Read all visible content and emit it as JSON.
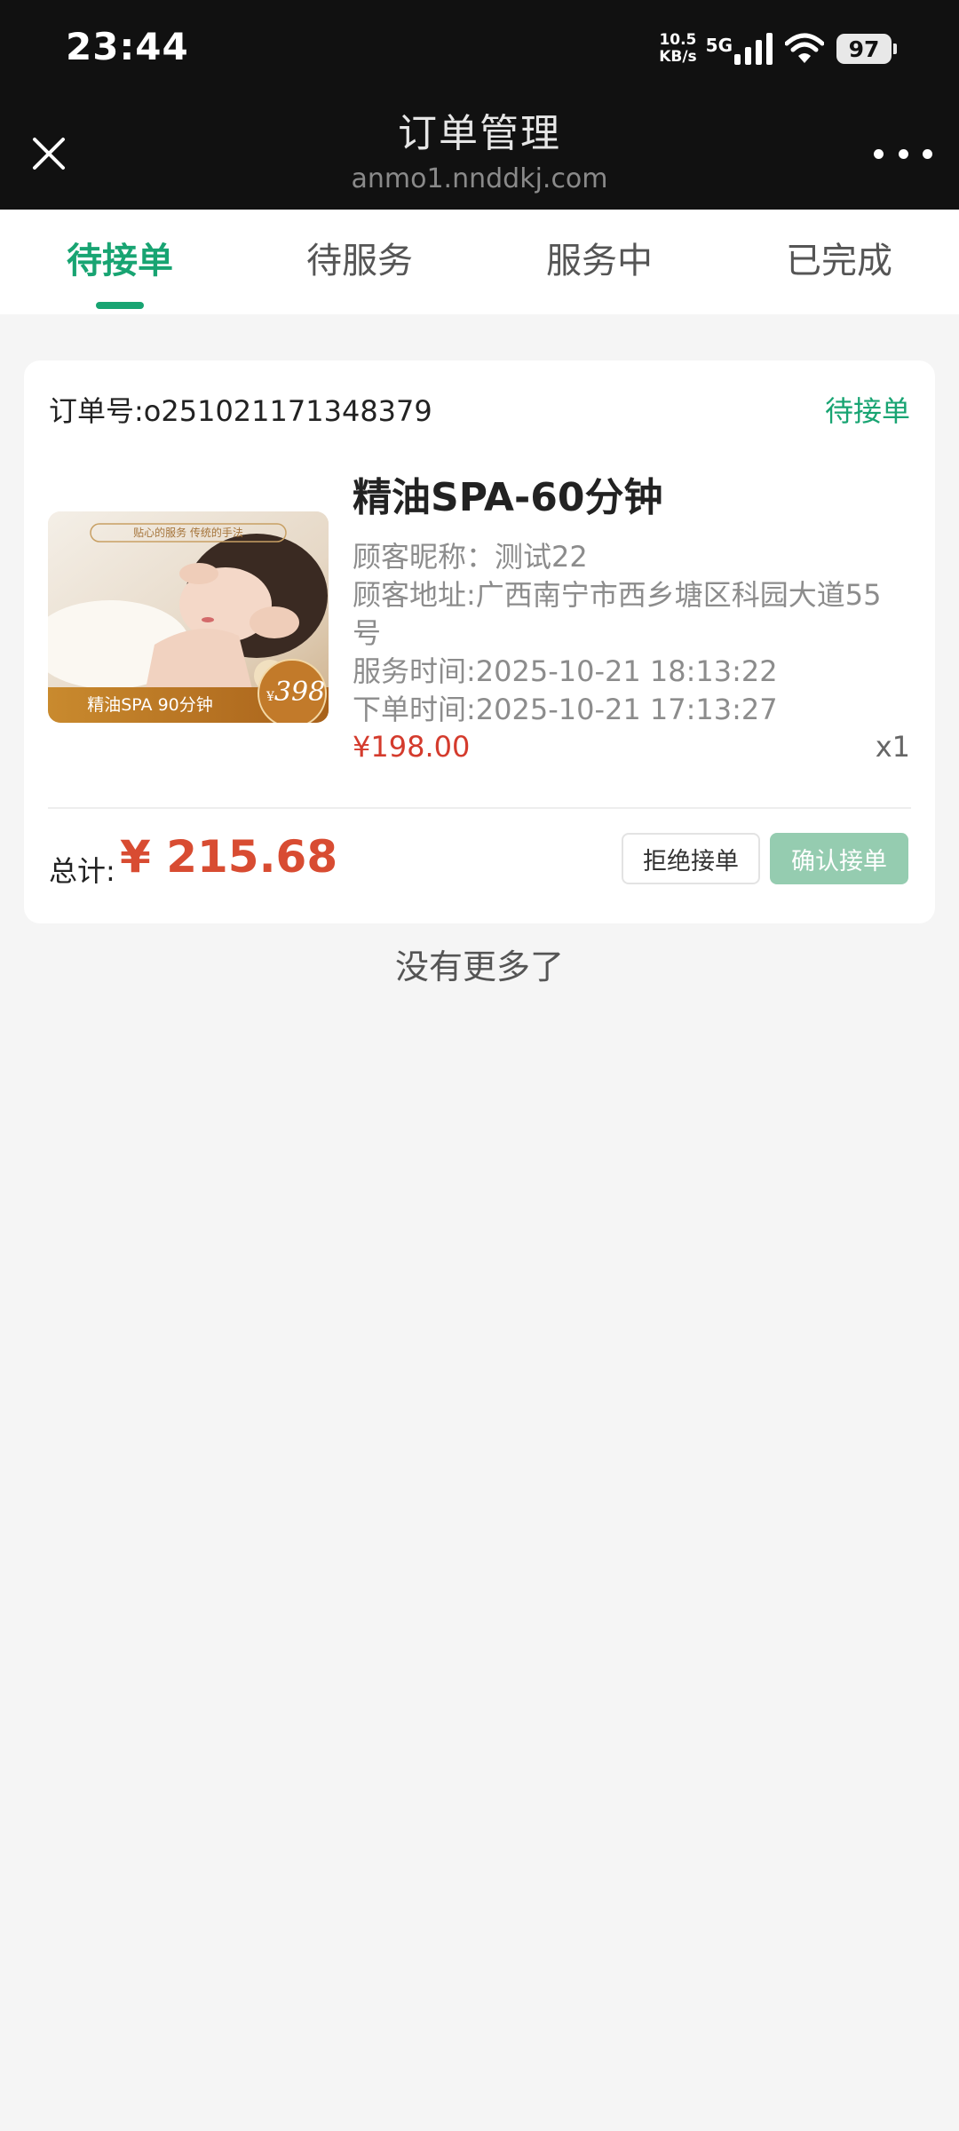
{
  "status_bar": {
    "time": "23:44",
    "net_speed_value": "10.5",
    "net_speed_unit": "KB/s",
    "network": "5G",
    "battery": "97"
  },
  "nav": {
    "title": "订单管理",
    "subtitle": "anmo1.nnddkj.com"
  },
  "tabs": [
    {
      "label": "待接单",
      "active": true
    },
    {
      "label": "待服务",
      "active": false
    },
    {
      "label": "服务中",
      "active": false
    },
    {
      "label": "已完成",
      "active": false
    }
  ],
  "order": {
    "order_no": "订单号:o251021171348379",
    "status": "待接单",
    "image": {
      "banner": "贴心的服务 传统的手法",
      "caption": "精油SPA 90分钟",
      "price_currency": "¥",
      "price": "398"
    },
    "title": "精油SPA-60分钟",
    "customer_name": "顾客昵称：测试22",
    "customer_address_line1": "顾客地址:广西南宁市西乡塘区科园大道55",
    "customer_address_line2": "号",
    "service_time": "服务时间:2025-10-21 18:13:22",
    "order_time": "下单时间:2025-10-21 17:13:27",
    "price": "¥198.00",
    "quantity": "x1",
    "total_label": "总计:",
    "total_value": "¥ 215.68",
    "reject_label": "拒绝接单",
    "confirm_label": "确认接单"
  },
  "footer_text": "没有更多了",
  "colors": {
    "accent": "#18a472",
    "price": "#d43b2d",
    "confirm_button": "#95ccb0"
  }
}
